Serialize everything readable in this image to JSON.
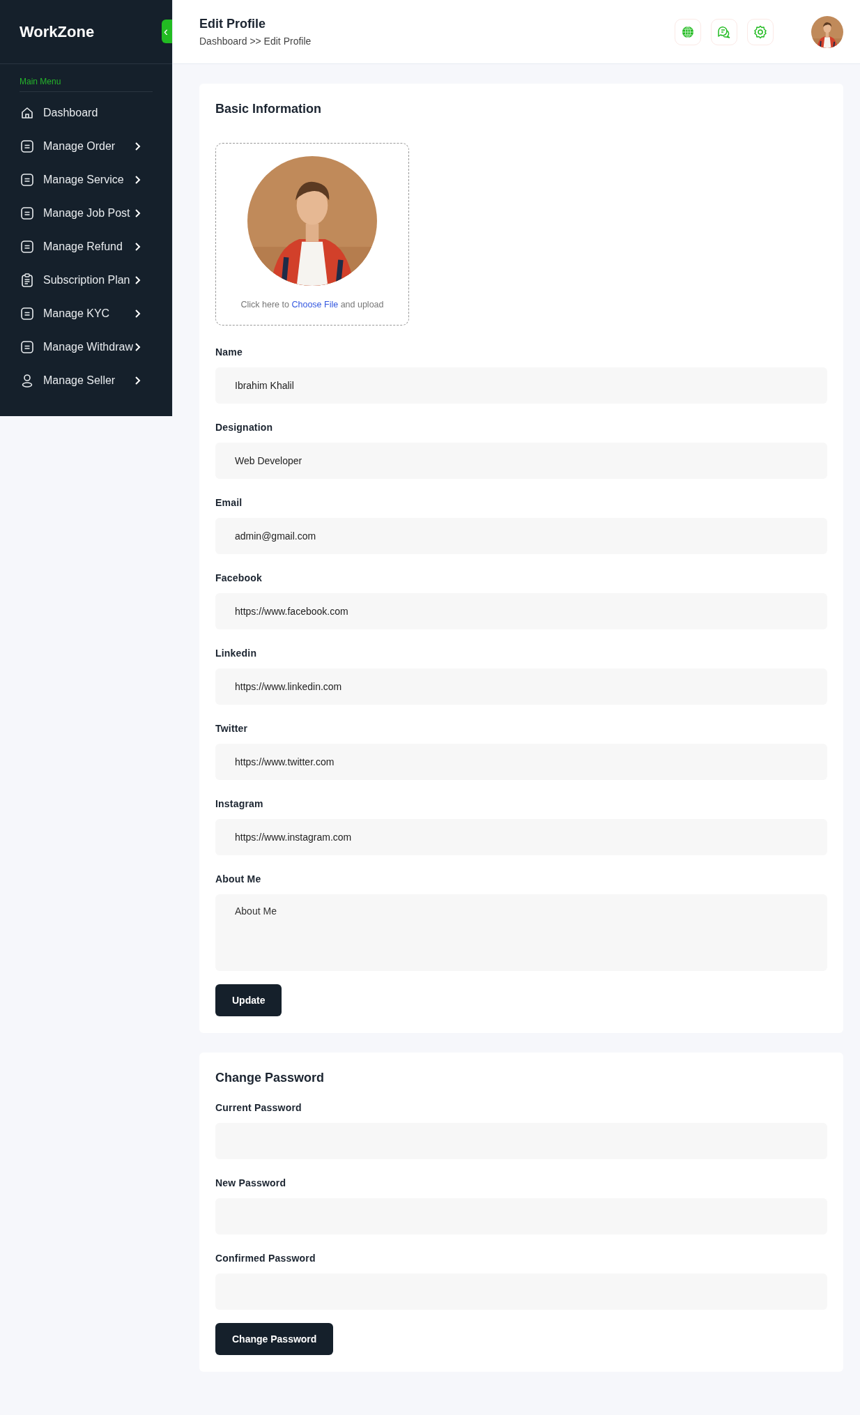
{
  "sidebar": {
    "logo": "WorkZone",
    "collapse_icon": "‹",
    "section_title": "Main Menu",
    "items": [
      {
        "label": "Dashboard",
        "kind": "home",
        "has_submenu": false
      },
      {
        "label": "Manage Order",
        "kind": "list",
        "has_submenu": true
      },
      {
        "label": "Manage Service",
        "kind": "list",
        "has_submenu": true
      },
      {
        "label": "Manage Job Post",
        "kind": "list",
        "has_submenu": true
      },
      {
        "label": "Manage Refund",
        "kind": "list",
        "has_submenu": true
      },
      {
        "label": "Subscription Plan",
        "kind": "clipboard",
        "has_submenu": true
      },
      {
        "label": "Manage KYC",
        "kind": "list",
        "has_submenu": true
      },
      {
        "label": "Manage Withdraw",
        "kind": "list",
        "has_submenu": true
      },
      {
        "label": "Manage Seller",
        "kind": "user",
        "has_submenu": true
      }
    ]
  },
  "header": {
    "title": "Edit Profile",
    "breadcrumb": "Dashboard >> Edit Profile",
    "actions": [
      {
        "kind": "globe"
      },
      {
        "kind": "chat"
      },
      {
        "kind": "gear"
      }
    ]
  },
  "basic_information": {
    "title": "Basic Information",
    "upload": {
      "kind": "picture",
      "before": "Click here to ",
      "link": "Choose File",
      "after": " and upload"
    },
    "fields": [
      {
        "label": "Name",
        "kind": "input",
        "value": "Ibrahim Khalil"
      },
      {
        "label": "Designation",
        "kind": "input",
        "value": "Web Developer"
      },
      {
        "label": "Email",
        "kind": "input",
        "value": "admin@gmail.com"
      },
      {
        "label": "Facebook",
        "kind": "input",
        "value": "https://www.facebook.com"
      },
      {
        "label": "Linkedin",
        "kind": "input",
        "value": "https://www.linkedin.com"
      },
      {
        "label": "Twitter",
        "kind": "input",
        "value": "https://www.twitter.com"
      },
      {
        "label": "Instagram",
        "kind": "input",
        "value": "https://www.instagram.com"
      },
      {
        "label": "About Me",
        "kind": "textarea",
        "placeholder": "About Me"
      }
    ],
    "button": "Update"
  },
  "change_password": {
    "title": "Change Password",
    "fields": [
      {
        "label": "Current Password",
        "kind": "password"
      },
      {
        "label": "New Password",
        "kind": "password"
      },
      {
        "label": "Confirmed Password",
        "kind": "password"
      }
    ],
    "button": "Change Password"
  }
}
